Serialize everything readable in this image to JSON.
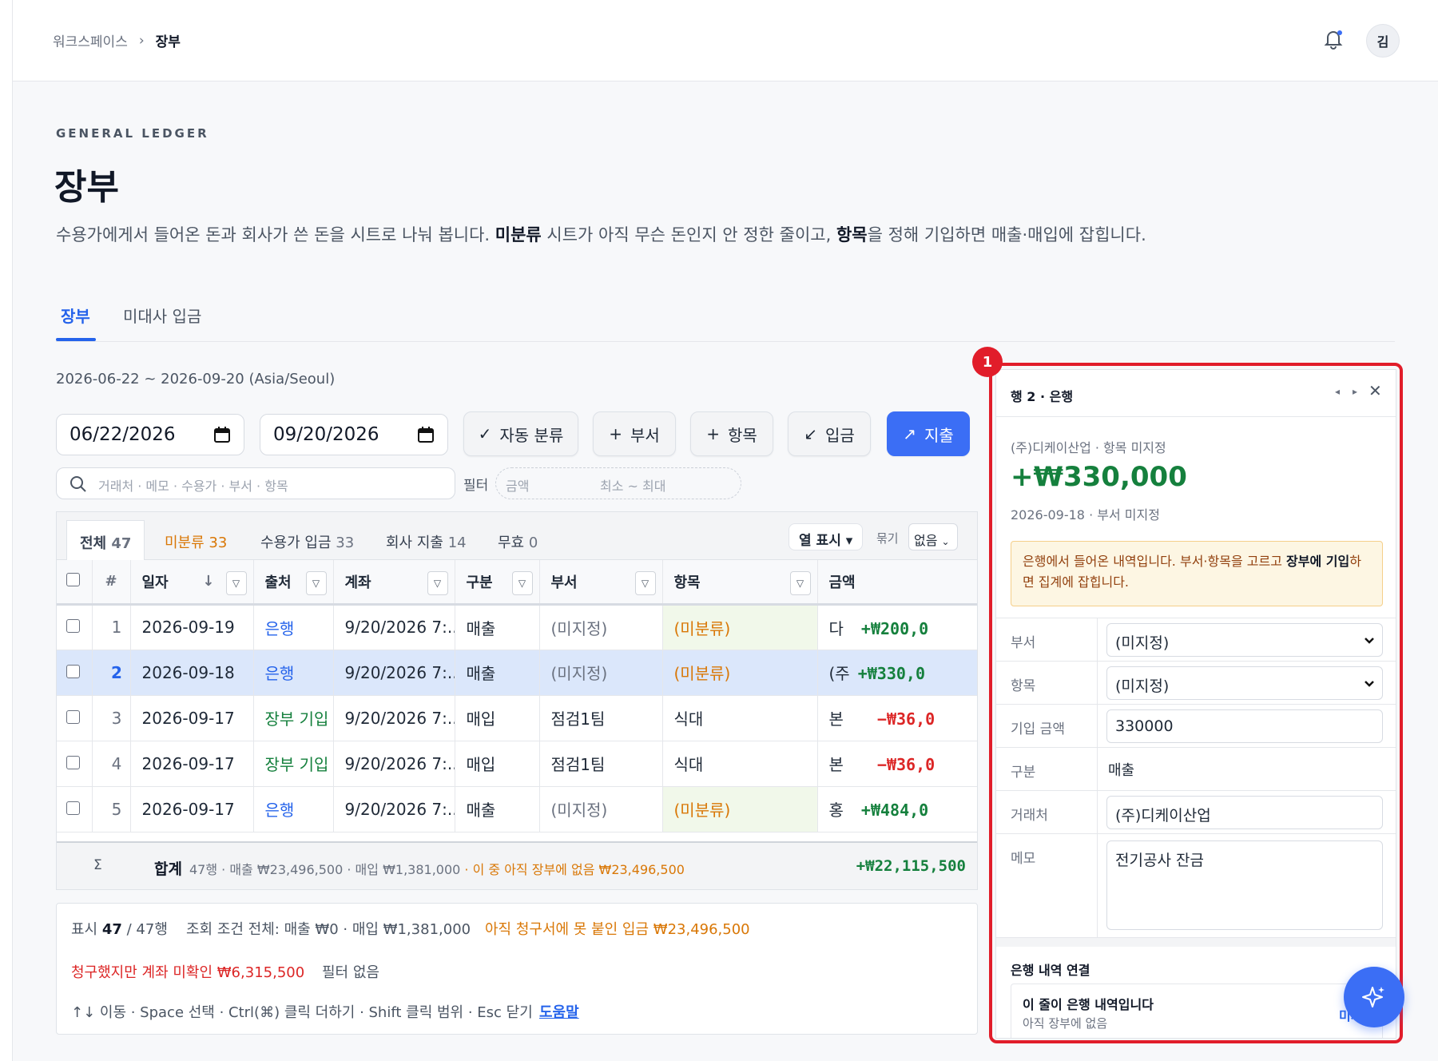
{
  "breadcrumb": {
    "workspace": "워크스페이스",
    "sep": "›",
    "current": "장부"
  },
  "user": {
    "avatar_initial": "김"
  },
  "header": {
    "eyebrow": "GENERAL LEDGER",
    "title": "장부",
    "desc_1": "수용가에게서 들어온 돈과 회사가 쓴 돈을 시트로 나눠 봅니다. ",
    "desc_b1": "미분류",
    "desc_2": " 시트가 아직 무슨 돈인지 안 정한 줄이고, ",
    "desc_b2": "항목",
    "desc_3": "을 정해 기입하면 매출·매입에 잡힙니다."
  },
  "tabs": [
    "장부",
    "미대사 입금"
  ],
  "range": "2026-06-22 ~ 2026-09-20 (Asia/Seoul)",
  "date_from": "06/22/2026",
  "date_to": "09/20/2026",
  "buttons": {
    "auto": "자동 분류",
    "dept": "부서",
    "item": "항목",
    "deposit": "입금",
    "expense": "지출"
  },
  "search": {
    "placeholder": "거래처 · 메모 · 수용가 · 부서 · 항목"
  },
  "filter": {
    "label": "필터",
    "amount": "금액",
    "minmax": "최소 ~ 최대"
  },
  "subtabs": [
    {
      "label": "전체",
      "count": "47"
    },
    {
      "label": "미분류",
      "count": "33"
    },
    {
      "label": "수용가 입금",
      "count": "33"
    },
    {
      "label": "회사 지출",
      "count": "14"
    },
    {
      "label": "무효",
      "count": "0"
    }
  ],
  "col_display": "열 표시 ▾",
  "group": {
    "label": "묶기",
    "value": "없음"
  },
  "columns": [
    "#",
    "일자",
    "출처",
    "계좌",
    "구분",
    "부서",
    "항목",
    "금액"
  ],
  "rows": [
    {
      "n": "1",
      "date": "2026-09-19",
      "src": "은행",
      "acct": "9/20/2026 7:...",
      "type": "매출",
      "dept": "(미지정)",
      "item": "(미분류)",
      "c": "다",
      "amt": "+₩200,0"
    },
    {
      "n": "2",
      "date": "2026-09-18",
      "src": "은행",
      "acct": "9/20/2026 7:...",
      "type": "매출",
      "dept": "(미지정)",
      "item": "(미분류)",
      "c": "(주",
      "amt": "+₩330,0"
    },
    {
      "n": "3",
      "date": "2026-09-17",
      "src": "장부 기입",
      "acct": "9/20/2026 7:...",
      "type": "매입",
      "dept": "점검1팀",
      "item": "식대",
      "c": "본",
      "amt": "−₩36,0"
    },
    {
      "n": "4",
      "date": "2026-09-17",
      "src": "장부 기입",
      "acct": "9/20/2026 7:...",
      "type": "매입",
      "dept": "점검1팀",
      "item": "식대",
      "c": "본",
      "amt": "−₩36,0"
    },
    {
      "n": "5",
      "date": "2026-09-17",
      "src": "은행",
      "acct": "9/20/2026 7:...",
      "type": "매출",
      "dept": "(미지정)",
      "item": "(미분류)",
      "c": "홍",
      "amt": "+₩484,0"
    }
  ],
  "sum": {
    "sigma": "Σ",
    "label": "합계",
    "detail": "47행 · 매출 ₩23,496,500 · 매입 ₩1,381,000",
    "warn": "· 이 중 아직 장부에 없음 ₩23,496,500",
    "total": "+₩22,115,500"
  },
  "footer": {
    "shown_pre": "표시 ",
    "shown": "47",
    "shown_post": " / 47행",
    "cond": "조회 조건 전체: 매출 ₩0 · 매입 ₩1,381,000",
    "unbilled": "아직 청구서에 못 붙인 입금 ₩23,496,500",
    "unpaid": "청구했지만 계좌 미확인 ₩6,315,500",
    "nofilter": "필터 없음",
    "keys": "↑↓ 이동 · Space 선택 · Ctrl(⌘) 클릭 더하기 · Shift 클릭 범위 · Esc 닫기",
    "help": "도움말"
  },
  "panel": {
    "badge": "1",
    "title": "행 2 · 은행",
    "sub": "(주)디케이산업 · 항목 미지정",
    "amount": "+₩330,000",
    "meta": "2026-09-18 · 부서 미지정",
    "note_1": "은행에서 들어온 내역입니다. 부서·항목을 고르고 ",
    "note_b": "장부에 기입",
    "note_2": "하면 집계에 잡힙니다.",
    "dept_label": "부서",
    "dept_value": "(미지정)",
    "item_label": "항목",
    "item_value": "(미지정)",
    "amt_label": "기입 금액",
    "amt_value": "330000",
    "type_label": "구분",
    "type_value": "매출",
    "party_label": "거래처",
    "party_value": "(주)디케이산업",
    "memo_label": "메모",
    "memo_value": "전기공사 잔금",
    "bank_title": "은행 내역 연결",
    "bank_line": "이 줄이 은행 내역입니다",
    "bank_sub": "아직 장부에 없음",
    "bank_link": "미지"
  },
  "colors": {
    "accent": "#3b6ef5",
    "positive": "#15803d",
    "negative": "#dc2626",
    "warning": "#d97706",
    "highlight": "#e11d2a"
  }
}
